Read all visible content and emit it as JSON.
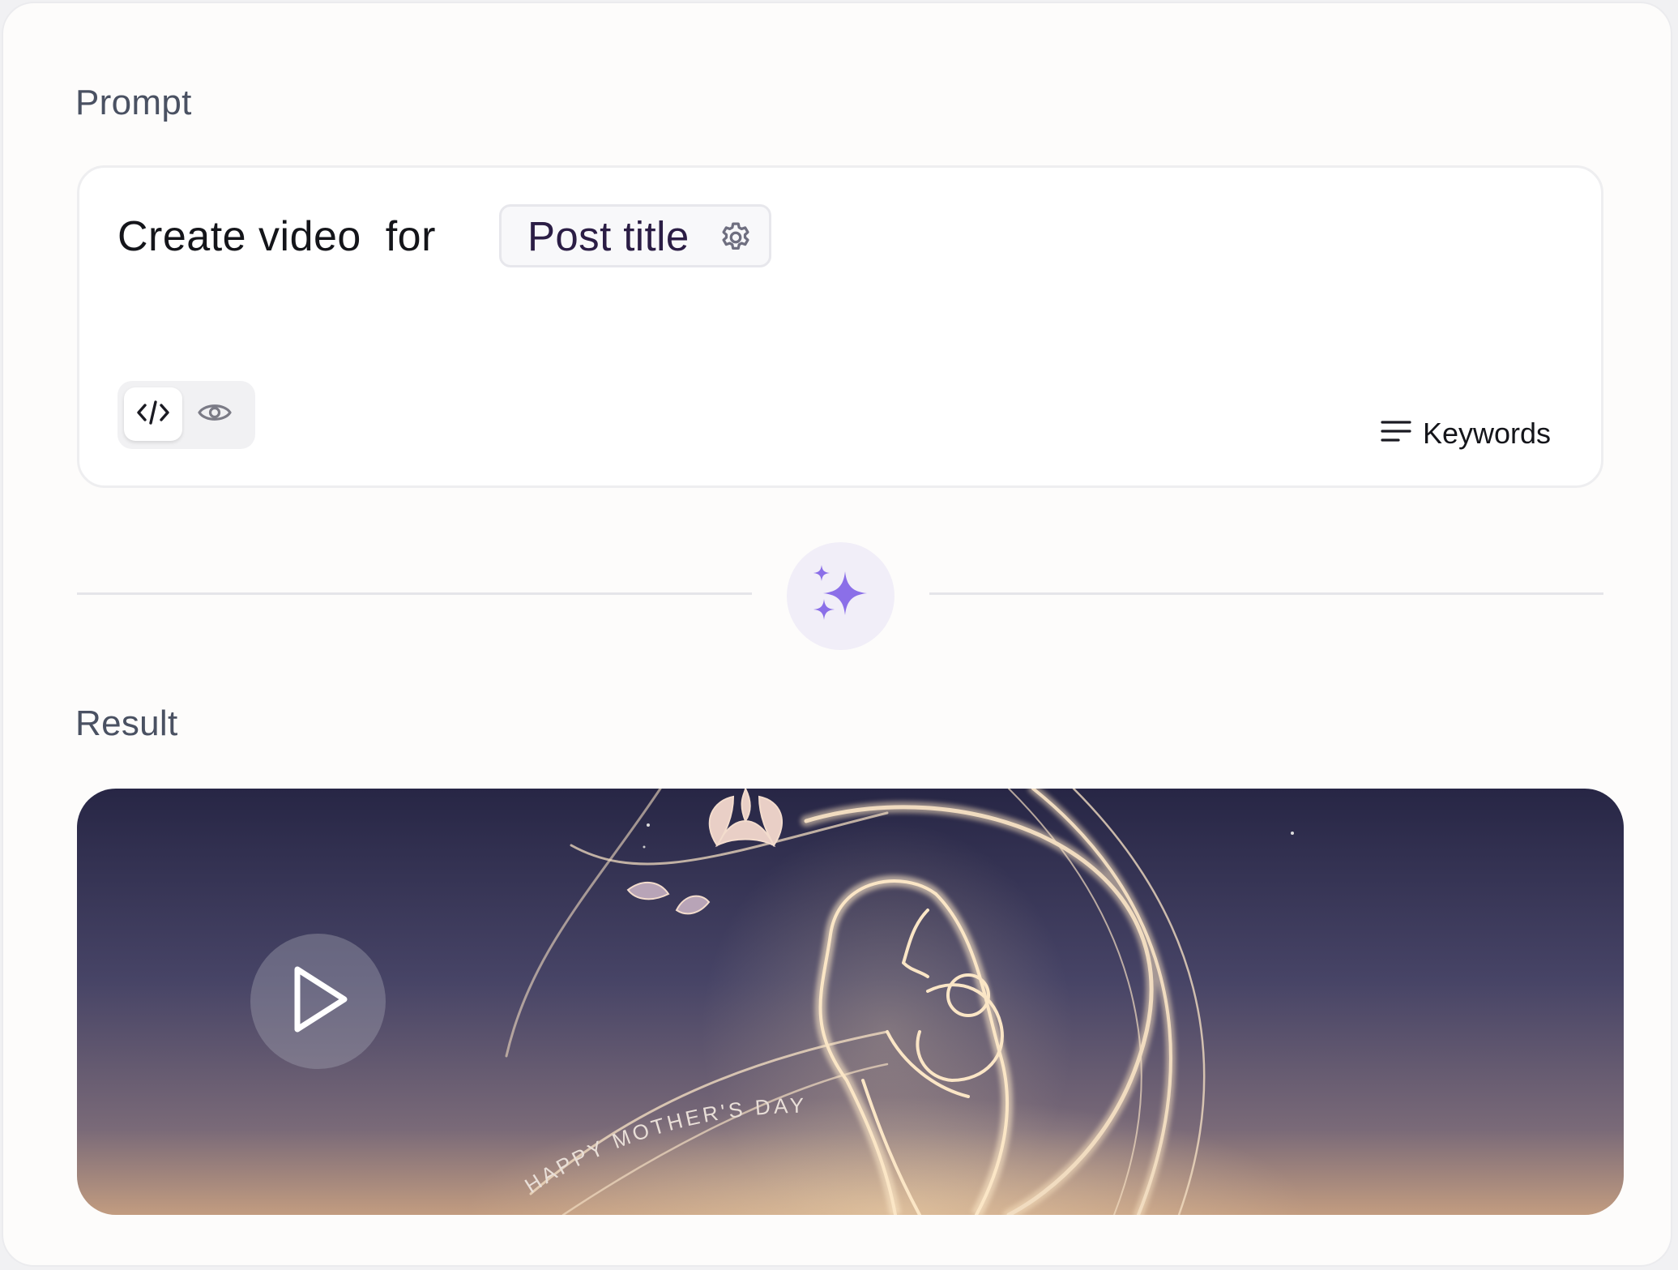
{
  "prompt_section": {
    "label": "Prompt",
    "text": "Create video  for ",
    "variable_chip": "Post title",
    "keywords_label": "Keywords"
  },
  "result_section": {
    "label": "Result",
    "video_caption": "HAPPY MOTHER'S DAY"
  },
  "icons": {
    "chip": "gear-icon",
    "code_mode": "code-icon",
    "preview_mode": "eye-icon",
    "keywords": "list-lines-icon",
    "generate": "sparkles-icon",
    "video": "play-icon"
  },
  "colors": {
    "accent": "#8b6fe8",
    "accent_bg": "#f1eef8",
    "chip_text": "#2b1d45",
    "label_text": "#4a5162"
  }
}
